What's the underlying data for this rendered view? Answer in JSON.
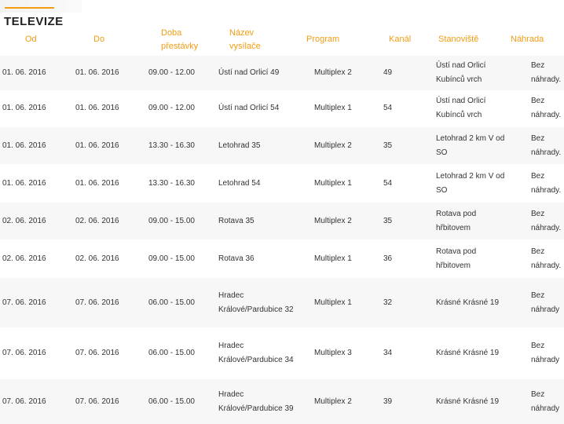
{
  "section": {
    "title": "TELEVIZE"
  },
  "table": {
    "headers": {
      "od": "Od",
      "do": "Do",
      "doba": "Doba přestávky",
      "nazev": "Název vysílače",
      "program": "Program",
      "kanal": "Kanál",
      "stanoviste": "Stanoviště",
      "nahrada": "Náhrada"
    },
    "rows": [
      {
        "od": "01. 06. 2016",
        "do": "01. 06. 2016",
        "doba": "09.00 - 12.00",
        "nazev": "Ústí nad Orlicí 49",
        "program": "Multiplex 2",
        "kanal": "49",
        "stanoviste": "Ústí nad Orlicí Kubínců vrch",
        "nahrada": "Bez náhrady."
      },
      {
        "od": "01. 06. 2016",
        "do": "01. 06. 2016",
        "doba": "09.00 - 12.00",
        "nazev": "Ústí nad Orlicí 54",
        "program": "Multiplex 1",
        "kanal": "54",
        "stanoviste": "Ústí nad Orlicí Kubínců vrch",
        "nahrada": "Bez náhrady."
      },
      {
        "od": "01. 06. 2016",
        "do": "01. 06. 2016",
        "doba": "13.30 - 16.30",
        "nazev": "Letohrad 35",
        "program": "Multiplex 2",
        "kanal": "35",
        "stanoviste": "Letohrad 2 km V od SO",
        "nahrada": "Bez náhrady."
      },
      {
        "od": "01. 06. 2016",
        "do": "01. 06. 2016",
        "doba": "13.30 - 16.30",
        "nazev": "Letohrad 54",
        "program": "Multiplex 1",
        "kanal": "54",
        "stanoviste": "Letohrad 2 km V od SO",
        "nahrada": "Bez náhrady."
      },
      {
        "od": "02. 06. 2016",
        "do": "02. 06. 2016",
        "doba": "09.00 - 15.00",
        "nazev": "Rotava 35",
        "program": "Multiplex 2",
        "kanal": "35",
        "stanoviste": "Rotava pod hřbitovem",
        "nahrada": "Bez náhrady."
      },
      {
        "od": "02. 06. 2016",
        "do": "02. 06. 2016",
        "doba": "09.00 - 15.00",
        "nazev": "Rotava 36",
        "program": "Multiplex 1",
        "kanal": "36",
        "stanoviste": "Rotava pod hřbitovem",
        "nahrada": "Bez náhrady."
      },
      {
        "od": "07. 06. 2016",
        "do": "07. 06. 2016",
        "doba": "06.00 - 15.00",
        "nazev": "Hradec Králové/Pardubice 32",
        "program": "Multiplex 1",
        "kanal": "32",
        "stanoviste": "Krásné Krásné 19",
        "nahrada": "Bez náhrady"
      },
      {
        "od": "07. 06. 2016",
        "do": "07. 06. 2016",
        "doba": "06.00 - 15.00",
        "nazev": "Hradec Králové/Pardubice 34",
        "program": "Multiplex 3",
        "kanal": "34",
        "stanoviste": "Krásné Krásné 19",
        "nahrada": "Bez náhrady"
      },
      {
        "od": "07. 06. 2016",
        "do": "07. 06. 2016",
        "doba": "06.00 - 15.00",
        "nazev": "Hradec Králové/Pardubice 39",
        "program": "Multiplex 2",
        "kanal": "39",
        "stanoviste": "Krásné Krásné 19",
        "nahrada": "Bez náhrady"
      }
    ]
  }
}
